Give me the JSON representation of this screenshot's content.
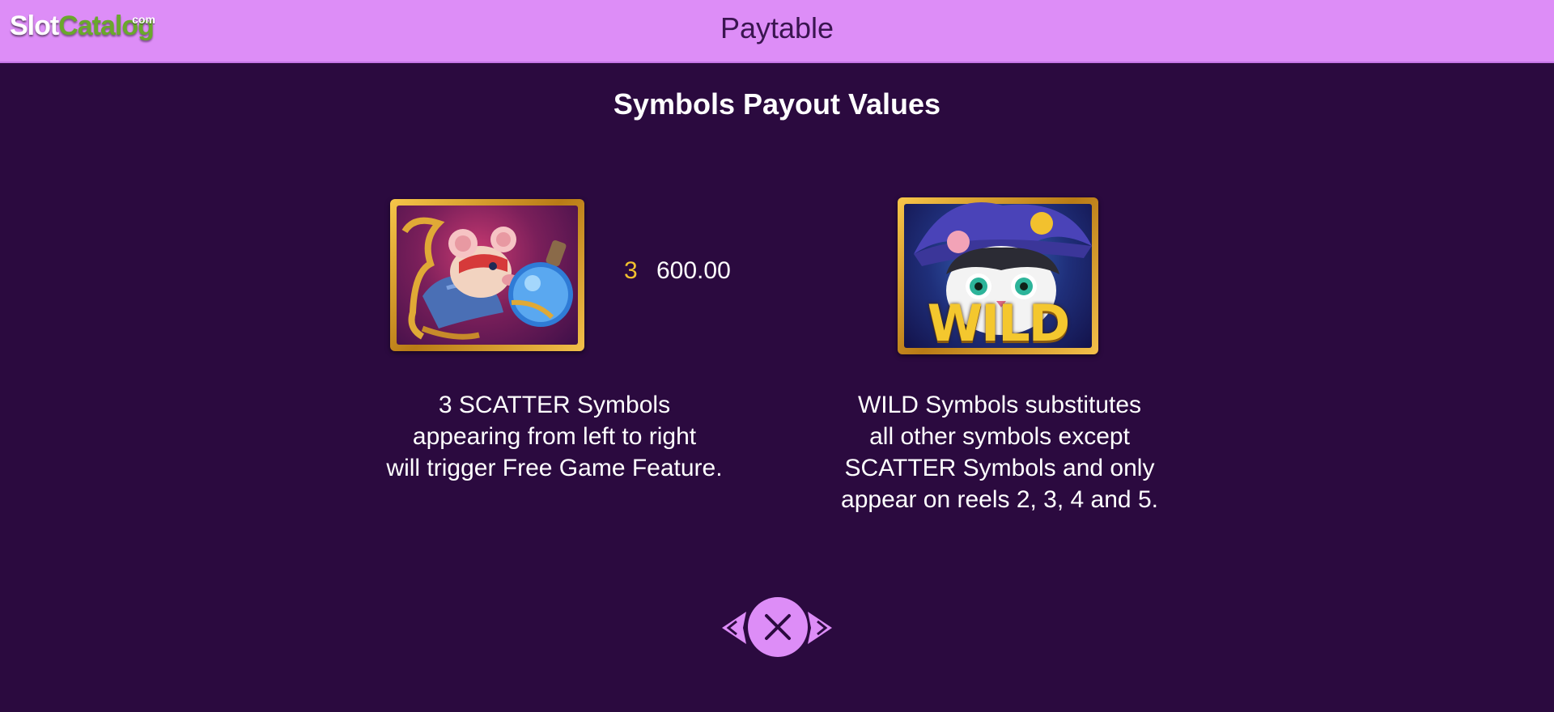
{
  "logo": {
    "slot": "Slot",
    "catalog": "Catalog",
    "com": "com"
  },
  "header": {
    "title": "Paytable"
  },
  "section": {
    "title": "Symbols Payout Values"
  },
  "scatter": {
    "payout_count": "3",
    "payout_value": "600.00",
    "description": [
      "3 SCATTER Symbols",
      "appearing from left to right",
      "will trigger Free Game Feature."
    ]
  },
  "wild": {
    "banner_text": "WILD",
    "description": [
      "WILD Symbols substitutes",
      "all other symbols except",
      "SCATTER Symbols and only",
      "appear on reels 2, 3, 4 and 5."
    ]
  },
  "nav": {
    "prev_icon": "chevron-left-icon",
    "close_icon": "close-icon",
    "next_icon": "chevron-right-icon"
  },
  "colors": {
    "background": "#2b0a3f",
    "header": "#dd8df7",
    "accent_yellow": "#f2c12e"
  }
}
